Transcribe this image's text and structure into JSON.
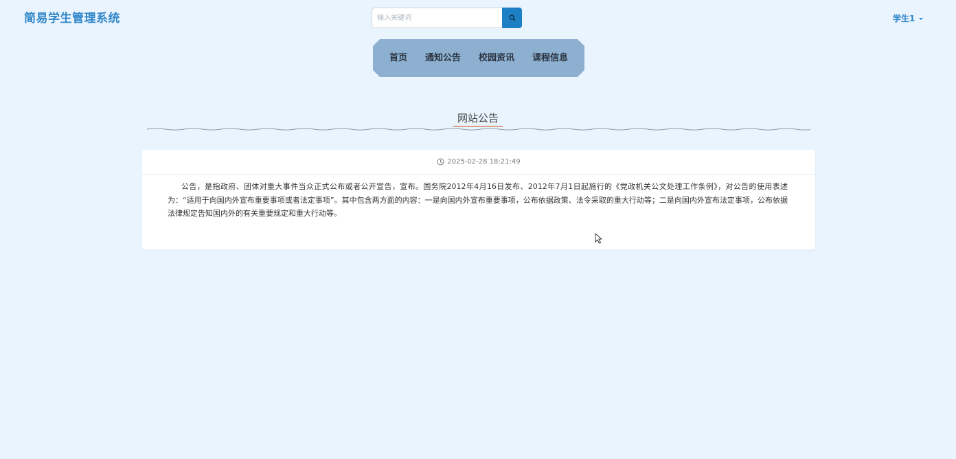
{
  "header": {
    "brand": "简易学生管理系统",
    "search": {
      "placeholder": "输入关键词",
      "value": ""
    },
    "user": "学生1"
  },
  "nav": {
    "items": [
      {
        "label": "首页"
      },
      {
        "label": "通知公告"
      },
      {
        "label": "校园资讯"
      },
      {
        "label": "课程信息"
      }
    ]
  },
  "section": {
    "title": "网站公告"
  },
  "notice": {
    "time": "2025-02-28 18:21:49",
    "content": "公告，是指政府、团体对重大事件当众正式公布或者公开宣告，宣布。国务院2012年4月16日发布、2012年7月1日起施行的《党政机关公文处理工作条例》，对公告的使用表述为：“适用于向国内外宣布重要事项或者法定事项”。其中包含两方面的内容：一是向国内外宣布重要事项，公布依据政策、法令采取的重大行动等；二是向国内外宣布法定事项，公布依据法律规定告知国内外的有关重要规定和重大行动等。"
  },
  "colors": {
    "background": "#eaf4fe",
    "brand": "#2f86c9",
    "search_button": "#1d7fc4",
    "nav_background": "#8eb0d0",
    "title_underline": "#d9a087"
  },
  "icons": {
    "search": "search-icon",
    "clock": "clock-icon",
    "caret": "caret-down-icon",
    "cursor": "mouse-cursor-icon"
  }
}
